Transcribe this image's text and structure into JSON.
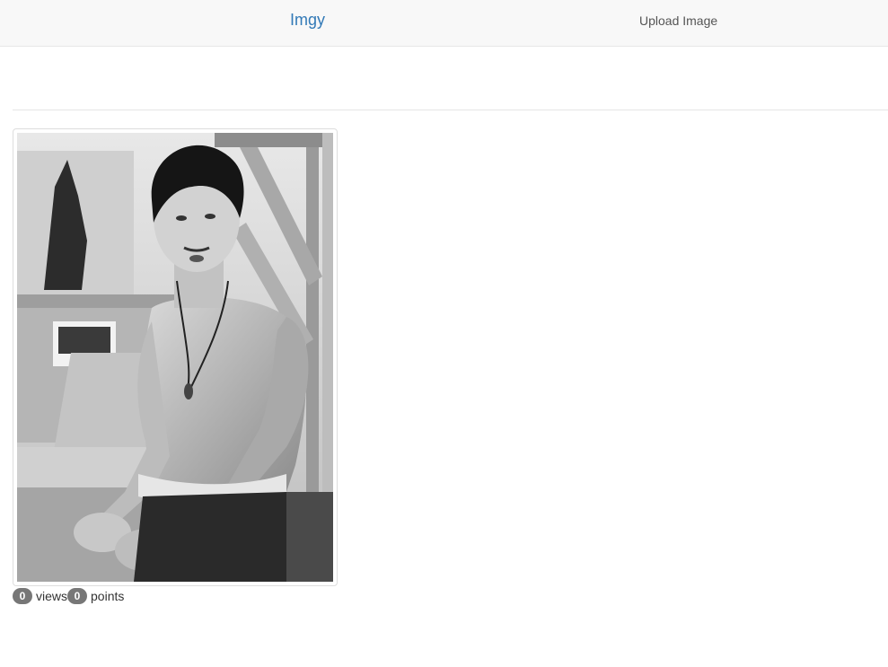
{
  "navbar": {
    "brand": "Imgy",
    "upload_link": "Upload Image"
  },
  "image": {
    "alt": "Black and white photo of a shirtless man in a martial arts pose"
  },
  "stats": {
    "views_count": "0",
    "views_label": "views",
    "points_count": "0",
    "points_label": "points"
  },
  "colors": {
    "brand": "#337ab7",
    "badge": "#777777",
    "navbar_bg": "#f8f8f8"
  }
}
